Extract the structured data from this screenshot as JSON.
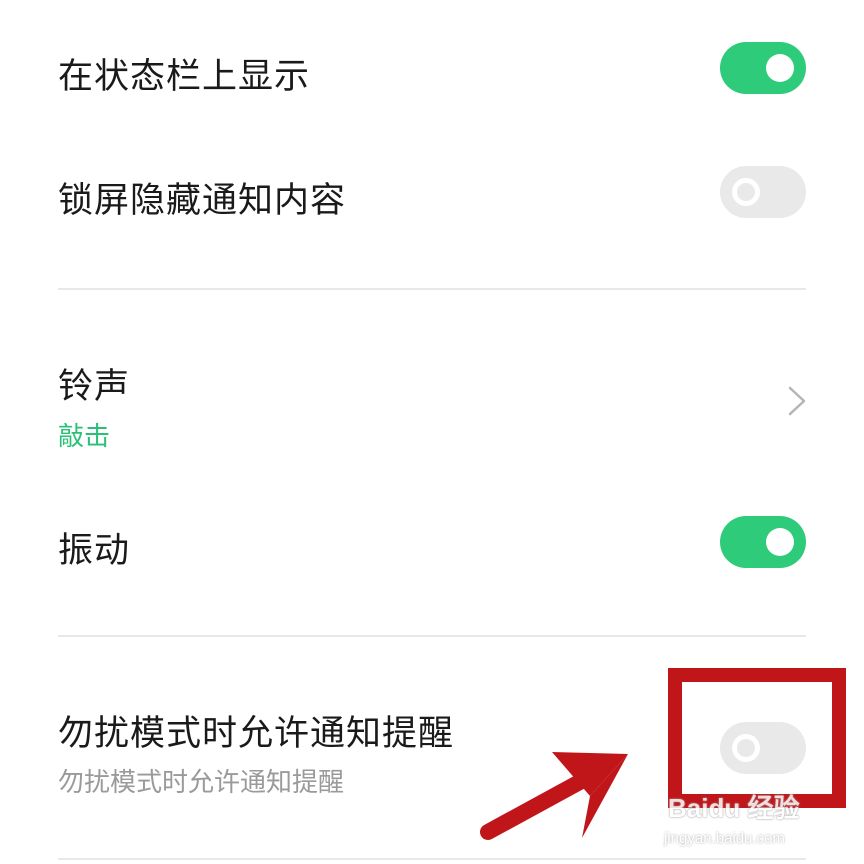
{
  "colors": {
    "accent_green": "#2ecc7a",
    "toggle_off": "#e9e9e9",
    "annotation_red": "#c0161a",
    "sub_green": "#29c176",
    "sub_gray": "#9a9a9a"
  },
  "settings": {
    "status_bar": {
      "label": "在状态栏上显示",
      "enabled": true
    },
    "lock_screen_hide": {
      "label": "锁屏隐藏通知内容",
      "enabled": false
    },
    "ringtone": {
      "label": "铃声",
      "value": "敲击",
      "icon": "chevron-right-icon"
    },
    "vibrate": {
      "label": "振动",
      "enabled": true
    },
    "dnd_allow": {
      "label": "勿扰模式时允许通知提醒",
      "description": "勿扰模式时允许通知提醒",
      "enabled": false
    }
  },
  "annotation": {
    "highlight": "red-rectangle",
    "pointer": "red-arrow-icon"
  },
  "watermark": {
    "brand": "Baidu 经验",
    "url": "jingyan.baidu.com"
  }
}
